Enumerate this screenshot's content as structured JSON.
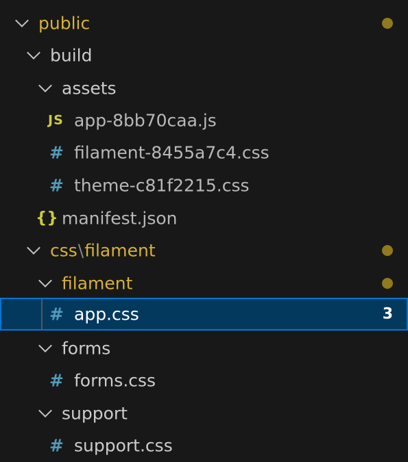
{
  "explorer": {
    "items": [
      {
        "label": "public",
        "kind": "folder",
        "state": "modified"
      },
      {
        "label": "build",
        "kind": "folder"
      },
      {
        "label": "assets",
        "kind": "folder"
      },
      {
        "label": "app-8bb70caa.js",
        "kind": "file",
        "icon": "js-file-icon",
        "icon_text": "JS"
      },
      {
        "label": "filament-8455a7c4.css",
        "kind": "file",
        "icon": "css-file-icon",
        "icon_text": "#"
      },
      {
        "label": "theme-c81f2215.css",
        "kind": "file",
        "icon": "css-file-icon",
        "icon_text": "#"
      },
      {
        "label": "manifest.json",
        "kind": "file",
        "icon": "json-file-icon",
        "icon_text": "{}"
      },
      {
        "label_part1": "css",
        "separator": "\\",
        "label_part2": "filament",
        "kind": "folder",
        "state": "modified"
      },
      {
        "label": "filament",
        "kind": "folder",
        "state": "modified"
      },
      {
        "label": "app.css",
        "kind": "file",
        "icon": "css-file-icon",
        "icon_text": "#",
        "badge": "3",
        "selected": true
      },
      {
        "label": "forms",
        "kind": "folder"
      },
      {
        "label": "forms.css",
        "kind": "file",
        "icon": "css-file-icon",
        "icon_text": "#"
      },
      {
        "label": "support",
        "kind": "folder"
      },
      {
        "label": "support.css",
        "kind": "file",
        "icon": "css-file-icon",
        "icon_text": "#"
      }
    ]
  },
  "colors": {
    "background": "#181818",
    "selection_bg": "#04395e",
    "selection_border": "#0078d4",
    "modified_text": "#d7b133",
    "modified_dot": "#8f7a1c",
    "css_icon": "#519aba",
    "js_icon": "#cbcb41"
  }
}
